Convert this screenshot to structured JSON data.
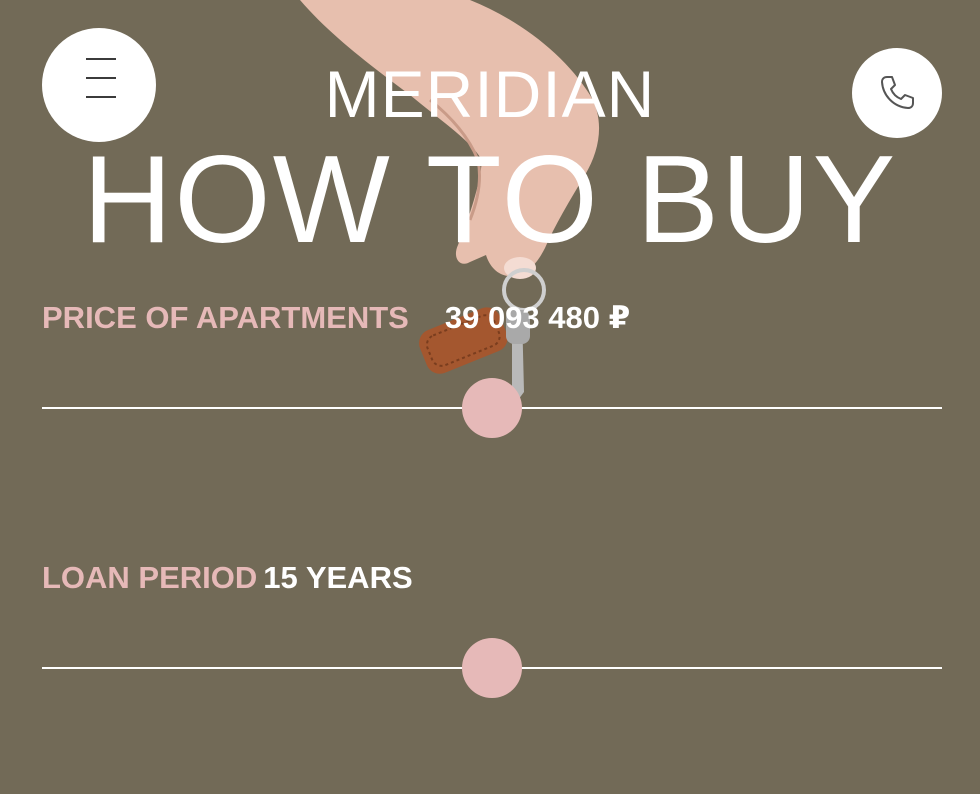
{
  "header": {
    "brand": "MERIDIAN",
    "menu_icon": "hamburger-icon",
    "phone_icon": "phone-icon"
  },
  "title": "HOW TO BUY",
  "calculator": {
    "price": {
      "label": "PRICE OF APARTMENTS",
      "value": "39 093 480 ₽",
      "slider_fraction": 0.5
    },
    "loan": {
      "label": "LOAN PERIOD",
      "value": "15 YEARS",
      "slider_fraction": 0.5
    }
  },
  "colors": {
    "background": "#726a57",
    "accent": "#e6b9b8",
    "text": "#ffffff"
  }
}
